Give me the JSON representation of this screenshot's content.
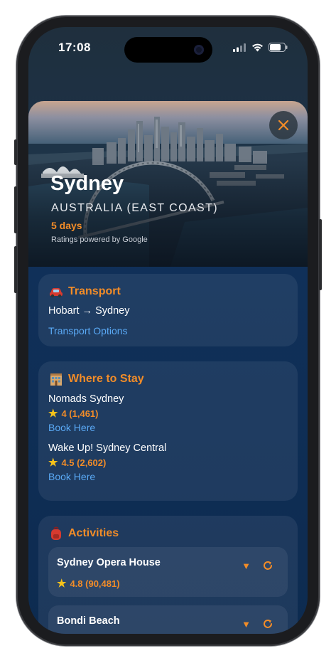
{
  "status_bar": {
    "time": "17:08",
    "battery_level": 0.75
  },
  "hero": {
    "title": "Sydney",
    "subtitle": "AUSTRALIA (EAST COAST)",
    "days": "5 days",
    "powered_by": "Ratings powered by Google"
  },
  "transport": {
    "icon": "car-icon",
    "title": "Transport",
    "route": "Hobart → Sydney",
    "options_link": "Transport Options"
  },
  "stay": {
    "icon": "hotel-icon",
    "title": "Where to Stay",
    "hotels": [
      {
        "name": "Nomads Sydney",
        "rating": "4 (1,461)",
        "link": "Book Here"
      },
      {
        "name": "Wake Up! Sydney Central",
        "rating": "4.5 (2,602)",
        "link": "Book Here"
      }
    ]
  },
  "activities": {
    "icon": "backpack-icon",
    "title": "Activities",
    "items": [
      {
        "name": "Sydney Opera House",
        "rating": "4.8 (90,481)"
      },
      {
        "name": "Bondi Beach"
      }
    ]
  },
  "colors": {
    "accent": "#f28c28",
    "link": "#5aa9f5",
    "star": "#f6c21a",
    "background": "#0d2b50"
  }
}
